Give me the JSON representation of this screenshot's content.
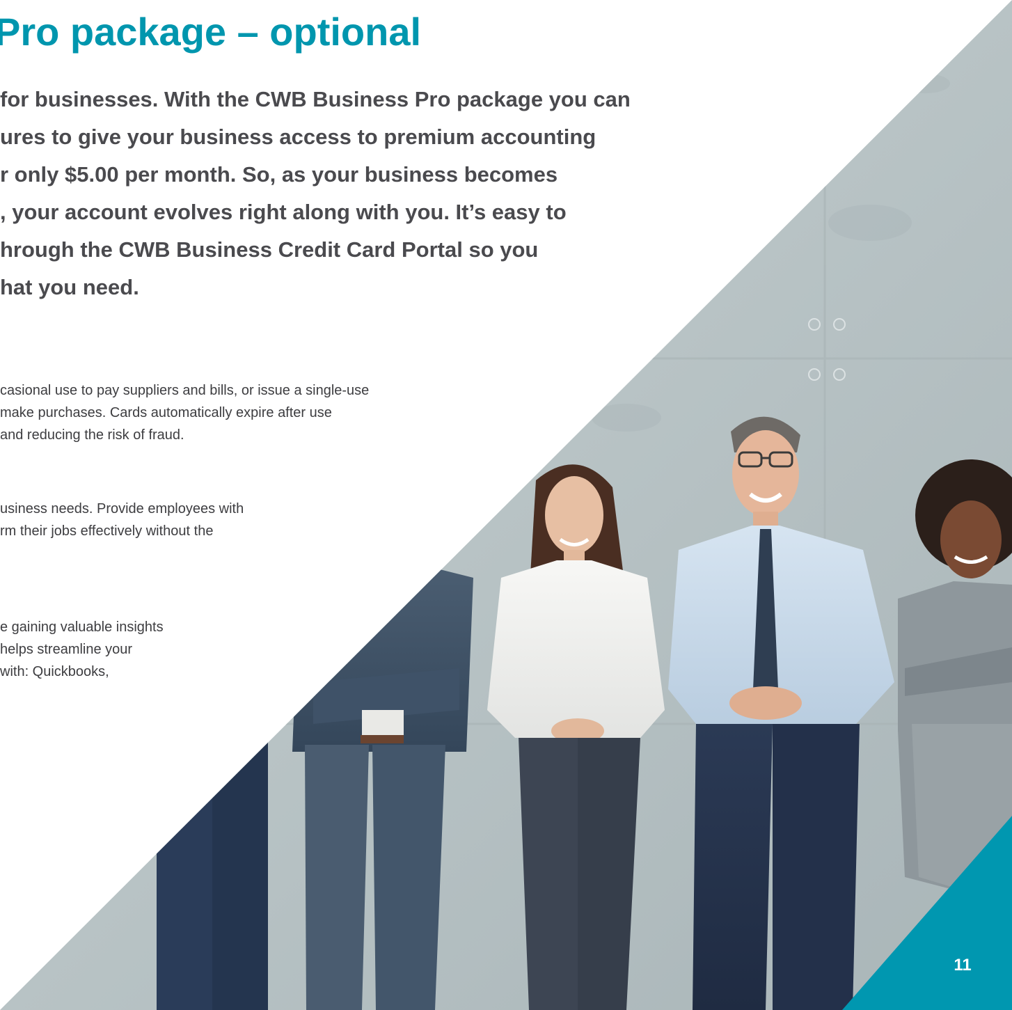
{
  "page": {
    "title": "Pro package – optional",
    "intro_lines": [
      "for businesses. With the CWB Business Pro package you can",
      "ures to give your business access to premium accounting",
      "r only $5.00 per month. So, as your business becomes",
      ", your account evolves right along with you. It’s easy to",
      "hrough the CWB Business Credit Card Portal so you",
      "hat you need."
    ],
    "paragraphs": [
      {
        "lines": [
          "casional use to pay suppliers and bills, or issue a single-use",
          "make purchases. Cards automatically expire after use",
          "and reducing the risk of fraud."
        ]
      },
      {
        "lines": [
          "usiness needs. Provide employees with",
          "rm their jobs effectively without the"
        ]
      },
      {
        "lines": [
          "e gaining valuable insights",
          " helps streamline your",
          " with: Quickbooks,"
        ]
      }
    ],
    "page_number": "11"
  },
  "photo": {
    "description_icon": "business-team-photo"
  },
  "colors": {
    "title": "#0096ae",
    "intro_text": "#4a4a4e",
    "body_text": "#3d3d40",
    "corner_accent": "#0097b0",
    "page_number": "#ffffff"
  }
}
